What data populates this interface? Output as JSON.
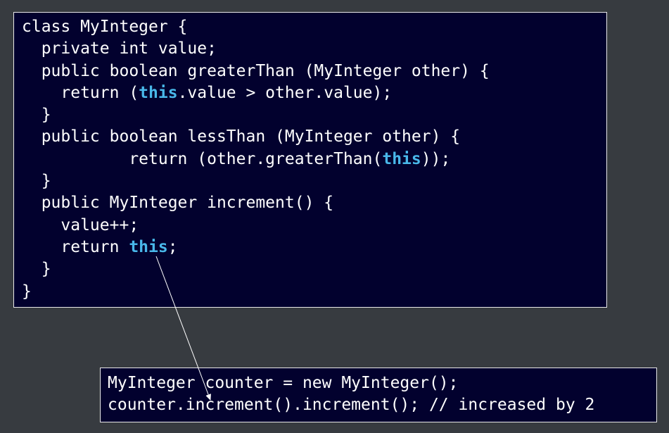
{
  "class_code": {
    "l1": "class MyInteger {",
    "l2": "  private int value;",
    "l3": "  public boolean greaterThan (MyInteger other) {",
    "l4_pre": "    return (",
    "l4_kw": "this",
    "l4_post": ".value > other.value);",
    "l5": "  }",
    "l6": "  public boolean lessThan (MyInteger other) {",
    "l7_pre": "           return (other.greaterThan(",
    "l7_kw": "this",
    "l7_post": "));",
    "l8": "  }",
    "l9": "  public MyInteger increment() {",
    "l10": "    value++;",
    "l11_pre": "    return ",
    "l11_kw": "this",
    "l11_post": ";",
    "l12": "  }",
    "l13": "}"
  },
  "usage_code": {
    "l1": "MyInteger counter = new MyInteger();",
    "l2": "counter.increment().increment(); // increased by 2"
  },
  "colors": {
    "background": "#373b40",
    "code_background": "#02012e",
    "code_text": "#ffffff",
    "keyword_highlight": "#49b8ea",
    "arrow": "#ffffff"
  }
}
